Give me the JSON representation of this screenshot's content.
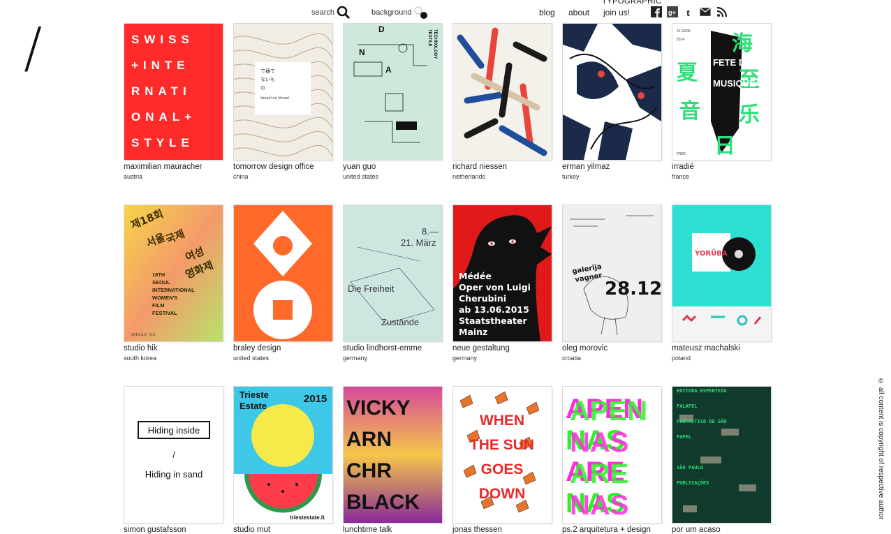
{
  "logo": {
    "glyph": "/"
  },
  "header": {
    "search_label": "search",
    "background_label": "background",
    "nav": [
      {
        "label": "blog"
      },
      {
        "label": "about"
      },
      {
        "label": "join us!"
      }
    ],
    "brand_text": "TYPOGRAPHIC",
    "social_icons": [
      "facebook-icon",
      "google-plus-icon",
      "tumblr-icon",
      "mail-icon",
      "rss-icon"
    ]
  },
  "posters": [
    {
      "name": "maximilian mauracher",
      "country": "austria",
      "bg": "#ff2a2a",
      "lines": [
        "SWISS",
        "+INTE",
        "RNATI",
        "ONAL+",
        "STYLE"
      ]
    },
    {
      "name": "tomorrow design office",
      "country": "china",
      "bg": "#f2ede4",
      "lines": [
        "で器で",
        "ないも",
        "の",
        "Vessel no Vessel"
      ]
    },
    {
      "name": "yuan guo",
      "country": "united states",
      "bg": "#cfe8dc",
      "lines": [
        "D",
        "N",
        "A",
        "TEXTILE",
        "TECHNOLOGY"
      ]
    },
    {
      "name": "richard niessen",
      "country": "netherlands",
      "bg": "#f4f1ea"
    },
    {
      "name": "erman yilmaz",
      "country": "turkey",
      "bg": "#ffffff"
    },
    {
      "name": "irradié",
      "country": "france",
      "bg": "#ffffff",
      "lines": [
        "FETE DE LA",
        "MUSIQUE",
        "21-22/06",
        "2014",
        "FREE"
      ]
    },
    {
      "name": "studio hik",
      "country": "south korea",
      "bg": "#f5d54a",
      "lines": [
        "제18회",
        "서울",
        "국제",
        "여성",
        "영화제",
        "18TH",
        "SEOUL",
        "INTERNATIONAL",
        "WOMEN'S",
        "FILM",
        "FESTIVAL",
        "2016.6.2 - 6.9"
      ]
    },
    {
      "name": "braley design",
      "country": "united states",
      "bg": "#ff6a2a"
    },
    {
      "name": "studio lindhorst-emme",
      "country": "germany",
      "bg": "#cde6e0",
      "lines": [
        "8.—",
        "21. März",
        "Die Freiheit",
        "Zustände"
      ]
    },
    {
      "name": "neue gestaltung",
      "country": "germany",
      "bg": "#e01a1a",
      "lines": [
        "Médée",
        "Oper von Luigi",
        "Cherubini",
        "ab 13.06.2015",
        "Staatstheater",
        "Mainz"
      ]
    },
    {
      "name": "oleg morovic",
      "country": "croatia",
      "bg": "#efefef",
      "lines": [
        "28.12.",
        "galerija",
        "vagner"
      ]
    },
    {
      "name": "mateusz machalski",
      "country": "poland",
      "bg": "#2ee0d4",
      "lines": [
        "YORÜBA"
      ]
    },
    {
      "name": "simon gustafsson",
      "country": "",
      "bg": "#ffffff",
      "lines": [
        "Hiding inside",
        "/",
        "Hiding in sand"
      ]
    },
    {
      "name": "studio mut",
      "country": "",
      "bg": "#ffffff",
      "lines": [
        "Trieste",
        "Estate",
        "2015",
        "triestestate.it"
      ]
    },
    {
      "name": "lunchtime talk",
      "country": "",
      "bg": "#7a2a8a",
      "lines": [
        "VICKY",
        "ARN",
        "CHR",
        "BLACK"
      ]
    },
    {
      "name": "jonas thessen",
      "country": "",
      "bg": "#ffffff",
      "lines": [
        "WHEN",
        "THE SUN",
        "GOES",
        "DOWN"
      ]
    },
    {
      "name": "ps.2 arquitetura + design",
      "country": "",
      "bg": "#ffffff",
      "lines": [
        "APEN",
        "NAS",
        "ARE",
        "NAS"
      ]
    },
    {
      "name": "por um acaso",
      "country": "",
      "bg": "#0f3a2c",
      "lines": [
        "EDITORA ESPERTEZA",
        "FALAFEL",
        "FANTÁSTICO DE SÃO",
        "PAPEL",
        "PUBLICAÇÕES",
        "SÃO PAULO"
      ]
    }
  ],
  "footer": {
    "copyright": "© all content is copyright of respective author"
  }
}
